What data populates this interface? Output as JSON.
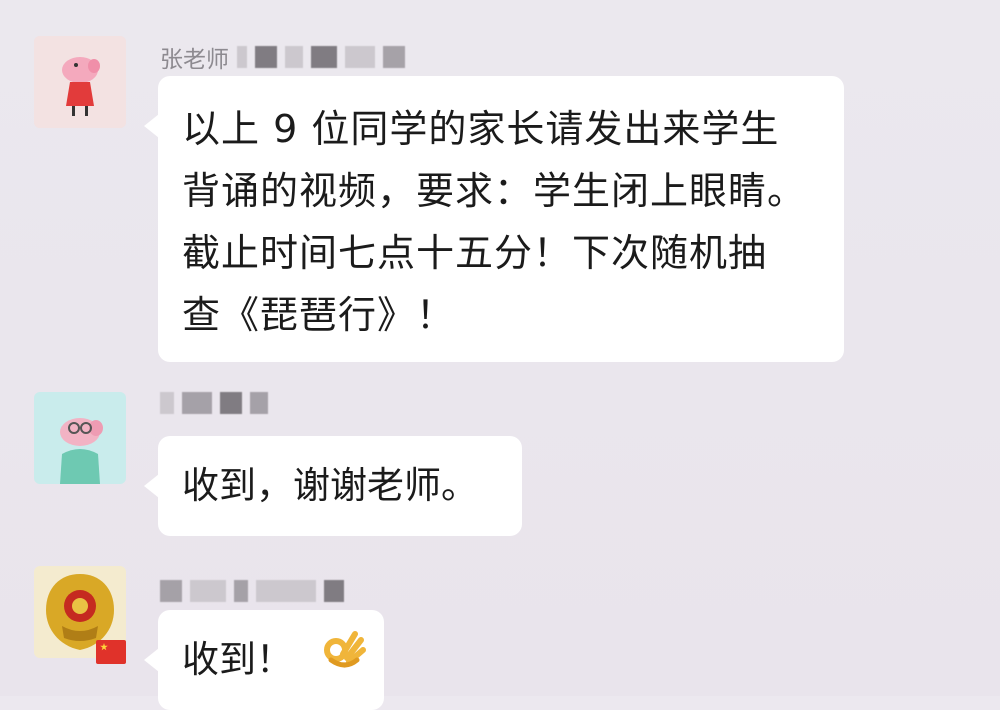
{
  "messages": [
    {
      "sender": "张老师",
      "lines": [
        "以上 9 位同学的家长请发出来学生",
        "背诵的视频，要求：学生闭上眼睛。",
        "截止时间七点十五分！下次随机抽",
        "查《琵琶行》！"
      ]
    },
    {
      "text": "收到，谢谢老师。"
    },
    {
      "text": "收到！"
    }
  ],
  "colors": {
    "background": "#ebe8ee",
    "bubble": "#ffffff",
    "nickname": "#8d8a90"
  }
}
